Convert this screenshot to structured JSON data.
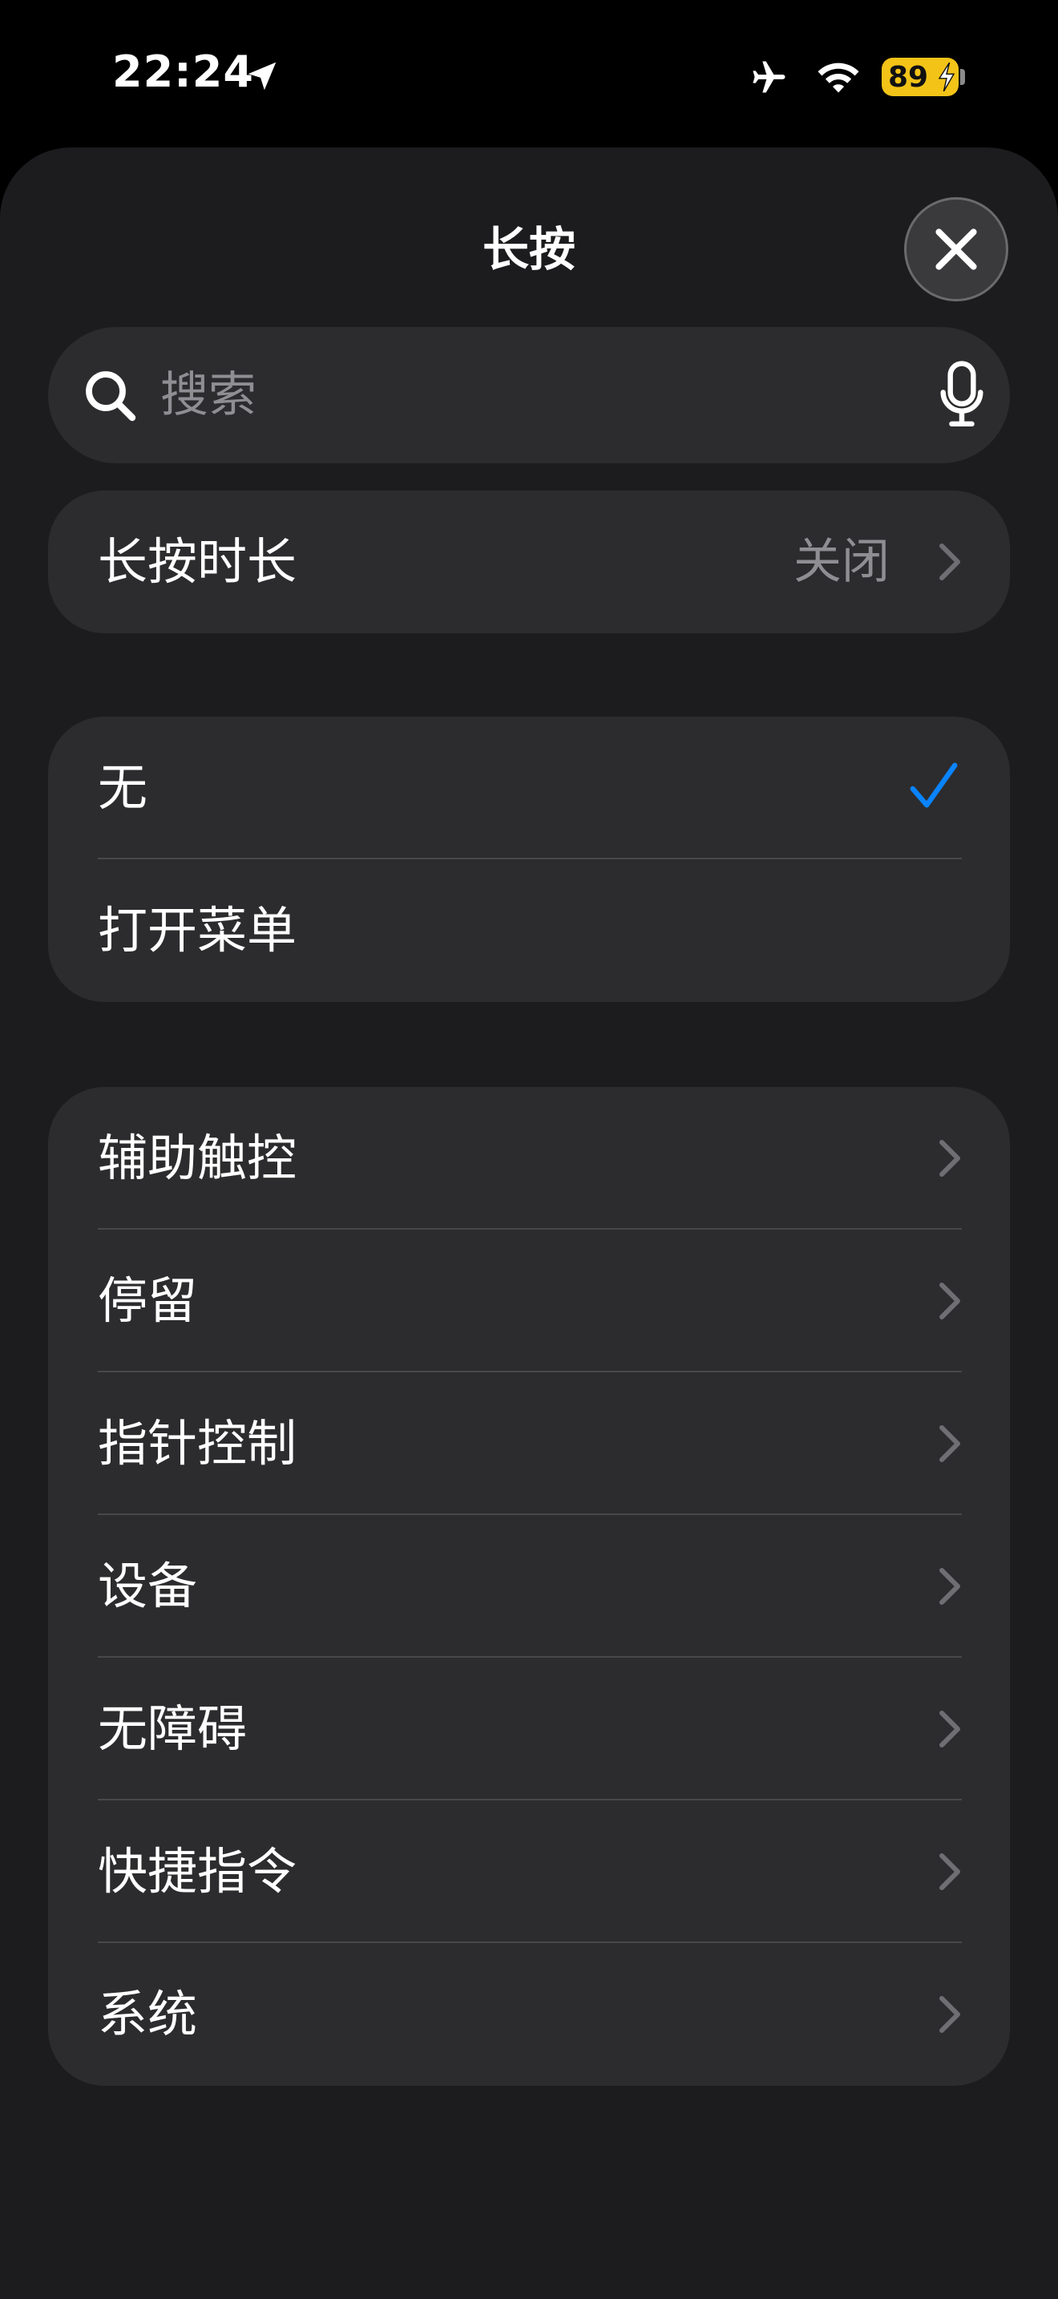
{
  "status_bar": {
    "time": "22:24",
    "battery_percent": "89",
    "icons": [
      "location-arrow-icon",
      "airplane-icon",
      "wifi-icon",
      "battery-charging-icon"
    ]
  },
  "sheet": {
    "title": "长按",
    "close_icon": "close-icon"
  },
  "search": {
    "placeholder": "搜索",
    "value": "",
    "icons": [
      "search-icon",
      "microphone-icon"
    ]
  },
  "duration_group": {
    "items": [
      {
        "label": "长按时长",
        "value": "关闭",
        "icon": "chevron-right-icon"
      }
    ]
  },
  "options_group": {
    "items": [
      {
        "label": "无",
        "selected": true,
        "icon": "checkmark-icon"
      },
      {
        "label": "打开菜单",
        "selected": false
      }
    ]
  },
  "categories_group": {
    "items": [
      {
        "label": "辅助触控"
      },
      {
        "label": "停留"
      },
      {
        "label": "指针控制"
      },
      {
        "label": "设备"
      },
      {
        "label": "无障碍"
      },
      {
        "label": "快捷指令"
      },
      {
        "label": "系统"
      }
    ]
  },
  "colors": {
    "background": "#000000",
    "sheet": "#1c1c1e",
    "cell": "#2c2c2e",
    "secondary_text": "#8e8e93",
    "accent": "#0a84ff",
    "battery": "#f3c318"
  }
}
